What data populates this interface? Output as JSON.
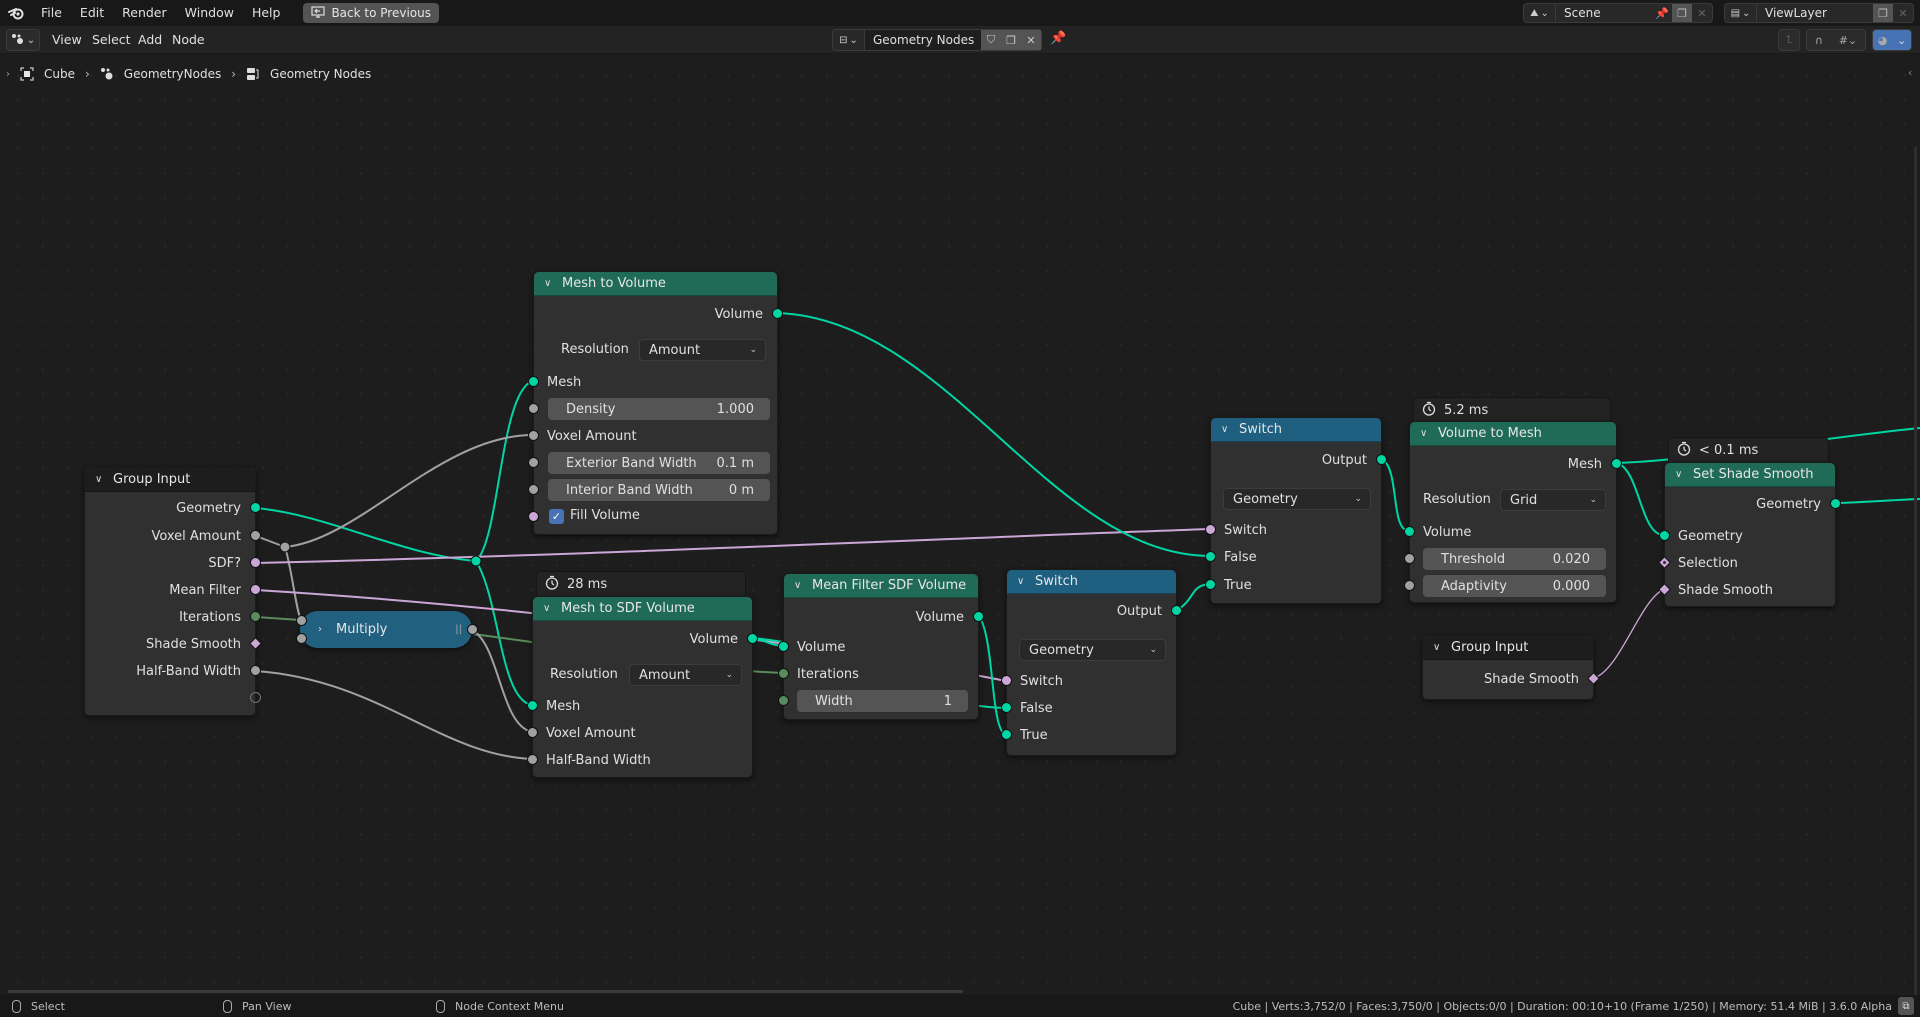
{
  "topbar": {
    "menus": [
      "File",
      "Edit",
      "Render",
      "Window",
      "Help"
    ],
    "back_button": "Back to Previous",
    "scene": "Scene",
    "view_layer": "ViewLayer"
  },
  "header": {
    "menus": [
      "View",
      "Select",
      "Add",
      "Node"
    ],
    "node_group": "Geometry Nodes"
  },
  "breadcrumb": {
    "items": [
      "Cube",
      "GeometryNodes",
      "Geometry Nodes"
    ]
  },
  "colors": {
    "geometry_socket": "#00d6a3",
    "float_socket": "#a1a1a1",
    "boolean_socket": "#cca6d6",
    "integer_socket": "#598c5c",
    "geometry_header": "#1f6b58",
    "utility_header": "#1f5f80"
  },
  "nodes": {
    "group_input": {
      "title": "Group Input",
      "outputs": [
        "Geometry",
        "Voxel Amount",
        "SDF?",
        "Mean Filter",
        "Iterations",
        "Shade Smooth",
        "Half-Band Width"
      ]
    },
    "mesh_to_volume": {
      "title": "Mesh to Volume",
      "output": "Volume",
      "resolution_label": "Resolution",
      "resolution_value": "Amount",
      "mesh_label": "Mesh",
      "density_label": "Density",
      "density_value": "1.000",
      "voxel_amount_label": "Voxel Amount",
      "exterior_label": "Exterior Band Width",
      "exterior_value": "0.1 m",
      "interior_label": "Interior Band Width",
      "interior_value": "0 m",
      "fill_volume_label": "Fill Volume",
      "fill_volume_checked": true
    },
    "multiply": {
      "title": "Multiply"
    },
    "mesh_to_sdf": {
      "timer": "28 ms",
      "title": "Mesh to SDF Volume",
      "output": "Volume",
      "resolution_label": "Resolution",
      "resolution_value": "Amount",
      "inputs": [
        "Mesh",
        "Voxel Amount",
        "Half-Band Width"
      ]
    },
    "mean_filter": {
      "title": "Mean Filter SDF Volume",
      "output": "Volume",
      "volume_label": "Volume",
      "iterations_label": "Iterations",
      "width_label": "Width",
      "width_value": "1"
    },
    "switch_a": {
      "title": "Switch",
      "output": "Output",
      "type": "Geometry",
      "inputs": [
        "Switch",
        "False",
        "True"
      ]
    },
    "switch_b": {
      "title": "Switch",
      "output": "Output",
      "type": "Geometry",
      "inputs": [
        "Switch",
        "False",
        "True"
      ]
    },
    "volume_to_mesh": {
      "timer": "5.2 ms",
      "title": "Volume to Mesh",
      "output": "Mesh",
      "resolution_label": "Resolution",
      "resolution_value": "Grid",
      "volume_label": "Volume",
      "threshold_label": "Threshold",
      "threshold_value": "0.020",
      "adaptivity_label": "Adaptivity",
      "adaptivity_value": "0.000"
    },
    "set_shade_smooth": {
      "timer": "< 0.1 ms",
      "title": "Set Shade Smooth",
      "output": "Geometry",
      "inputs": [
        "Geometry",
        "Selection",
        "Shade Smooth"
      ]
    },
    "group_input_2": {
      "title": "Group Input",
      "output": "Shade Smooth"
    }
  },
  "statusbar": {
    "select": "Select",
    "pan": "Pan View",
    "context": "Node Context Menu",
    "stats": "Cube | Verts:3,752/0 | Faces:3,750/0 | Objects:0/0 | Duration: 00:10+10 (Frame 1/250) | Memory: 51.4 MiB | 3.6.0 Alpha"
  }
}
